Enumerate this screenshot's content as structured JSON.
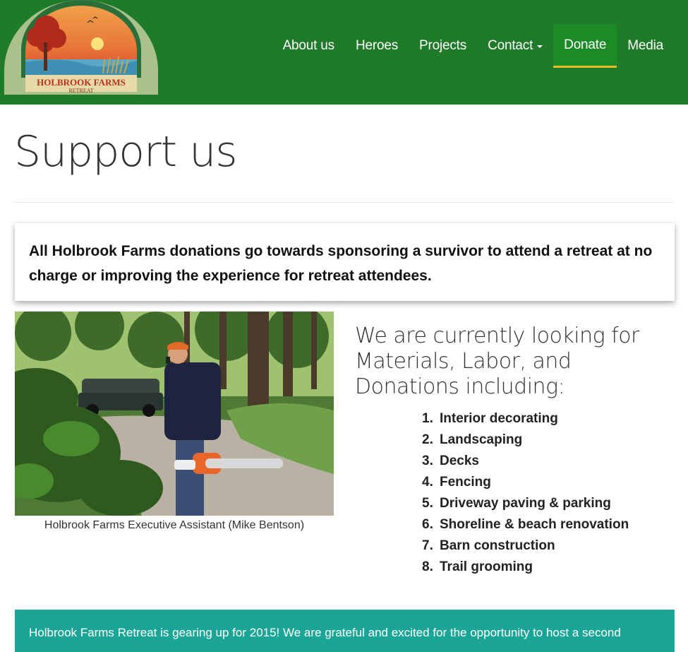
{
  "header": {
    "logo_text": "HOLBROOK FARMS",
    "logo_subtext": "RETREAT",
    "nav": [
      {
        "label": "About us"
      },
      {
        "label": "Heroes"
      },
      {
        "label": "Projects"
      },
      {
        "label": "Contact"
      },
      {
        "label": "Donate"
      },
      {
        "label": "Media"
      }
    ],
    "colors": {
      "header_bg": "#1f7a2a",
      "active_bg": "#1a8b25",
      "active_underline": "#e8b923"
    }
  },
  "page": {
    "title": "Support us",
    "callout": "All Holbrook Farms donations go towards sponsoring a survivor to attend a retreat at no charge or improving the experience for retreat attendees.",
    "photo_caption": "Holbrook Farms Executive Assistant (Mike Bentson)",
    "looking_heading": "We are currently looking for Materials, Labor, and Donations including:",
    "needs": [
      {
        "num": "1.",
        "label": "Interior decorating"
      },
      {
        "num": "2.",
        "label": "Landscaping"
      },
      {
        "num": "3.",
        "label": "Decks"
      },
      {
        "num": "4.",
        "label": "Fencing"
      },
      {
        "num": "5.",
        "label": "Driveway paving & parking"
      },
      {
        "num": "6.",
        "label": "Shoreline & beach renovation"
      },
      {
        "num": "7.",
        "label": "Barn construction"
      },
      {
        "num": "8.",
        "label": "Trail grooming"
      }
    ],
    "banner": "Holbrook Farms Retreat is gearing up for 2015! We are grateful and excited for the opportunity to host a second",
    "colors": {
      "banner_bg": "#1aa596"
    }
  }
}
